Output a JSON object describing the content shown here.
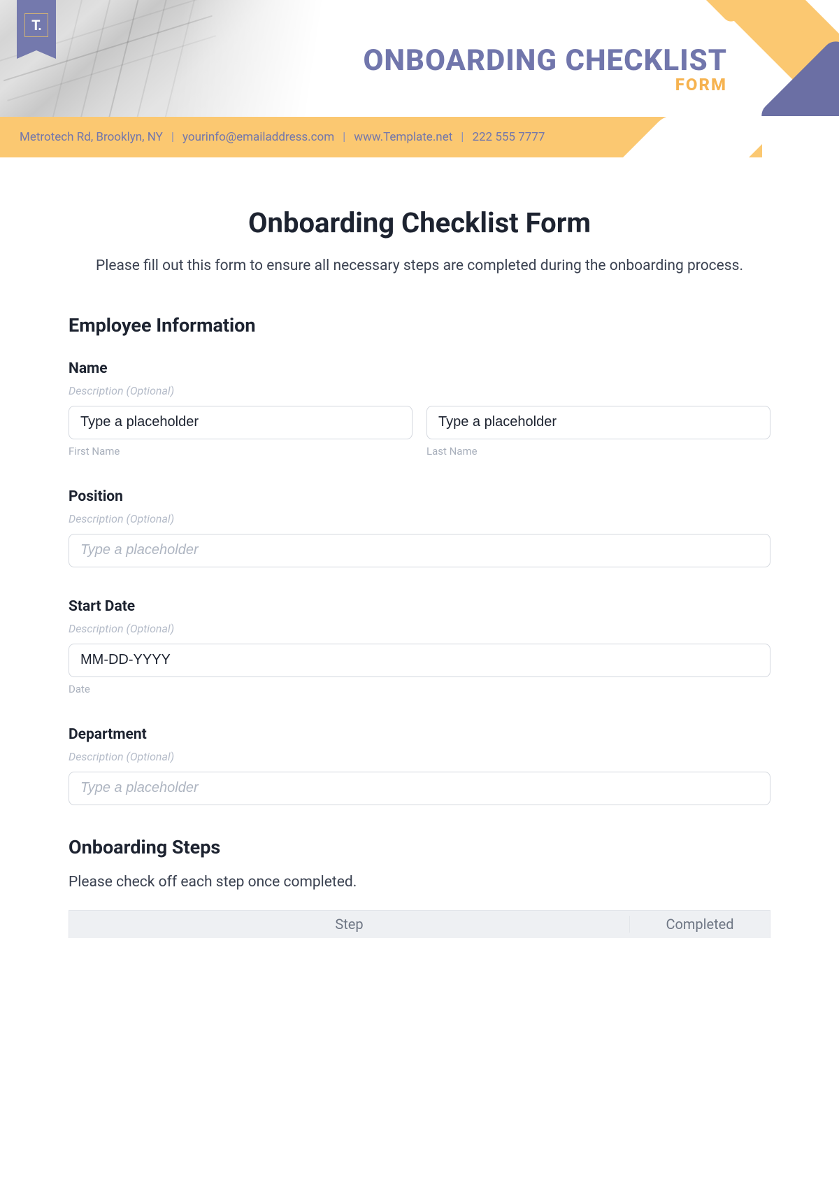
{
  "banner": {
    "logo_letter": "T.",
    "title": "ONBOARDING CHECKLIST",
    "subtitle": "FORM",
    "address": "Metrotech Rd, Brooklyn, NY",
    "email": "yourinfo@emailaddress.com",
    "website": "www.Template.net",
    "phone": "222 555 7777",
    "separator": "|"
  },
  "form": {
    "title": "Onboarding Checklist Form",
    "intro": "Please fill out this form to ensure all necessary steps are completed during the onboarding process.",
    "section_employee": "Employee Information",
    "desc_optional": "Description (Optional)",
    "name": {
      "label": "Name",
      "first_value": "Type a placeholder",
      "first_sub": "First Name",
      "last_value": "Type a placeholder",
      "last_sub": "Last Name"
    },
    "position": {
      "label": "Position",
      "placeholder": "Type a placeholder"
    },
    "start_date": {
      "label": "Start Date",
      "value": "MM-DD-YYYY",
      "sub": "Date"
    },
    "department": {
      "label": "Department",
      "placeholder": "Type a placeholder"
    },
    "section_steps": "Onboarding Steps",
    "steps_intro": "Please check off each step once completed.",
    "table": {
      "col_step": "Step",
      "col_completed": "Completed"
    }
  }
}
